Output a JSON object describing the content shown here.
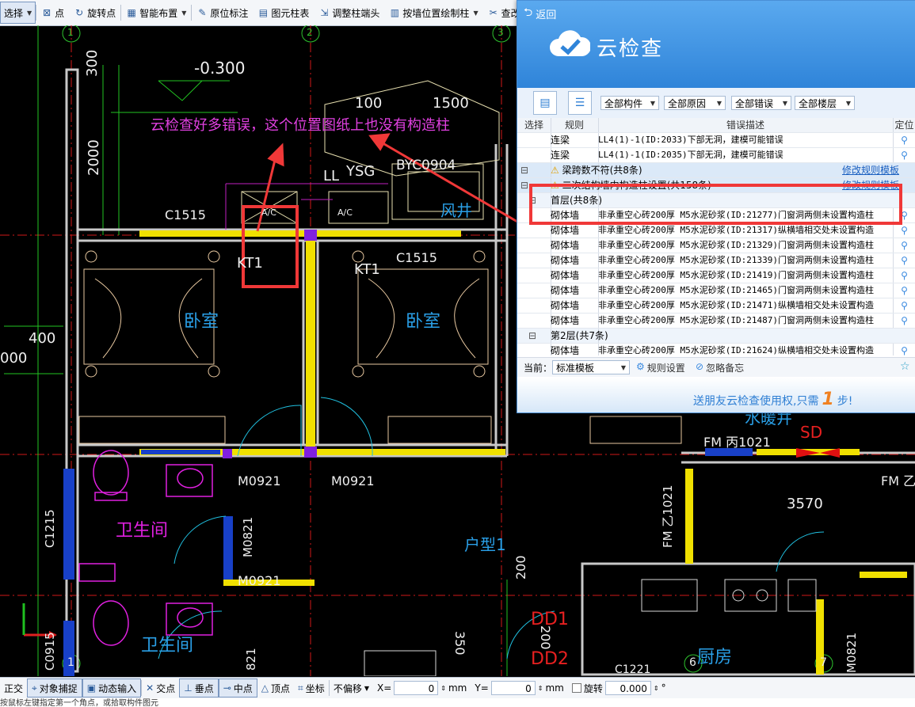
{
  "toolbar": {
    "select": "选择",
    "point": "点",
    "rotate_point": "旋转点",
    "smart_layout": "智能布置",
    "origin_mark": "原位标注",
    "element_table": "图元柱表",
    "adjust_column_end": "调整柱端头",
    "draw_column_by_wall": "按墙位置绘制柱",
    "check": "查改"
  },
  "cad": {
    "axis_labels": [
      "1",
      "2",
      "3",
      "6",
      "7",
      "1"
    ],
    "dims": {
      "d300": "300",
      "d2000": "2000",
      "dneg300": "-0.300",
      "d100": "100",
      "d1500": "1500",
      "d400": "400",
      "d000": "000",
      "d3570": "3570",
      "d200": "200",
      "d350": "350",
      "d2002": "200"
    },
    "labels": {
      "ll": "LL",
      "ysg": "YSG",
      "byc0904": "BYC0904",
      "fengjing": "风井",
      "c1515a": "C1515",
      "c1515b": "C1515",
      "kt1a": "KT1",
      "kt1b": "KT1",
      "woshi1": "卧室",
      "woshi2": "卧室",
      "ac1": "A/C",
      "ac2": "A/C",
      "m0921a": "M0921",
      "m0921b": "M0921",
      "m0921c": "M0921",
      "weisheng1": "卫生间",
      "weisheng2": "卫生间",
      "c1215": "C1215",
      "m0821": "M0821",
      "huxing": "户型1",
      "dd1": "DD1",
      "dd2": "DD2",
      "chufang": "厨房",
      "c1221": "C1221",
      "fm1021a": "FM 丙1021",
      "fm1021b": "FM 乙1021",
      "fm": "FM 乙",
      "sd": "SD",
      "shuinuan": "水暖井",
      "m0821b": "M0821",
      "c0915": "C0915",
      "m0821c": "821"
    },
    "annotation": "云检查好多错误，这个位置图纸上也没有构造柱"
  },
  "panel": {
    "back": "返回",
    "title": "云检查",
    "filters": [
      "全部构件",
      "全部原因",
      "全部错误",
      "全部楼层"
    ],
    "columns": [
      "选择",
      "规则",
      "错误描述",
      "定位"
    ],
    "rows": [
      {
        "type": "item",
        "rule": "连梁",
        "desc": "LL4(1)-1(ID:2033)下部无洞，建模可能错误"
      },
      {
        "type": "item",
        "rule": "连梁",
        "desc": "LL4(1)-1(ID:2035)下部无洞，建模可能错误"
      },
      {
        "type": "group",
        "rule": "",
        "desc": "梁跨数不符(共8条)",
        "link": "修改规则模板"
      },
      {
        "type": "group",
        "rule": "",
        "desc": "二次结构墙内构造柱设置(共158条)",
        "link": "修改规则模板"
      },
      {
        "type": "sub",
        "rule": "",
        "desc": "首层(共8条)"
      },
      {
        "type": "item",
        "rule": "砌体墙",
        "desc": "非承重空心砖200厚 M5水泥砂浆(ID:21277)门窗洞两侧未设置构造柱"
      },
      {
        "type": "item",
        "rule": "砌体墙",
        "desc": "非承重空心砖200厚 M5水泥砂浆(ID:21317)纵横墙相交处未设置构造"
      },
      {
        "type": "item",
        "rule": "砌体墙",
        "desc": "非承重空心砖200厚 M5水泥砂浆(ID:21329)门窗洞两侧未设置构造柱"
      },
      {
        "type": "item",
        "rule": "砌体墙",
        "desc": "非承重空心砖200厚 M5水泥砂浆(ID:21339)门窗洞两侧未设置构造柱"
      },
      {
        "type": "item",
        "rule": "砌体墙",
        "desc": "非承重空心砖200厚 M5水泥砂浆(ID:21419)门窗洞两侧未设置构造柱"
      },
      {
        "type": "item",
        "rule": "砌体墙",
        "desc": "非承重空心砖200厚 M5水泥砂浆(ID:21465)门窗洞两侧未设置构造柱"
      },
      {
        "type": "item",
        "rule": "砌体墙",
        "desc": "非承重空心砖200厚 M5水泥砂浆(ID:21471)纵横墙相交处未设置构造"
      },
      {
        "type": "item",
        "rule": "砌体墙",
        "desc": "非承重空心砖200厚 M5水泥砂浆(ID:21487)门窗洞两侧未设置构造柱"
      },
      {
        "type": "sub",
        "rule": "",
        "desc": "第2层(共7条)"
      },
      {
        "type": "item",
        "rule": "砌体墙",
        "desc": "非承重空心砖200厚 M5水泥砂浆(ID:21624)纵横墙相交处未设置构造"
      }
    ],
    "current_label": "当前：",
    "template_value": "标准模板",
    "rule_settings": "规则设置",
    "ignore_notes": "忽略备忘",
    "promo_text": "送朋友云检查使用权,只需",
    "promo_num": "1",
    "promo_step": "步!"
  },
  "bottombar": {
    "ortho": "正交",
    "snap": "对象捕捉",
    "dynamic": "动态输入",
    "intersection": "交点",
    "perpendicular": "垂点",
    "midpoint": "中点",
    "vertex": "顶点",
    "coordinate": "坐标",
    "offset": "不偏移",
    "x_label": "X=",
    "x_value": "0",
    "mm1": "mm",
    "y_label": "Y=",
    "y_value": "0",
    "mm2": "mm",
    "rotate": "旋转",
    "rotate_value": "0.000"
  },
  "cmdline": "按鼠标左键指定第一个角点，或拾取构件图元"
}
